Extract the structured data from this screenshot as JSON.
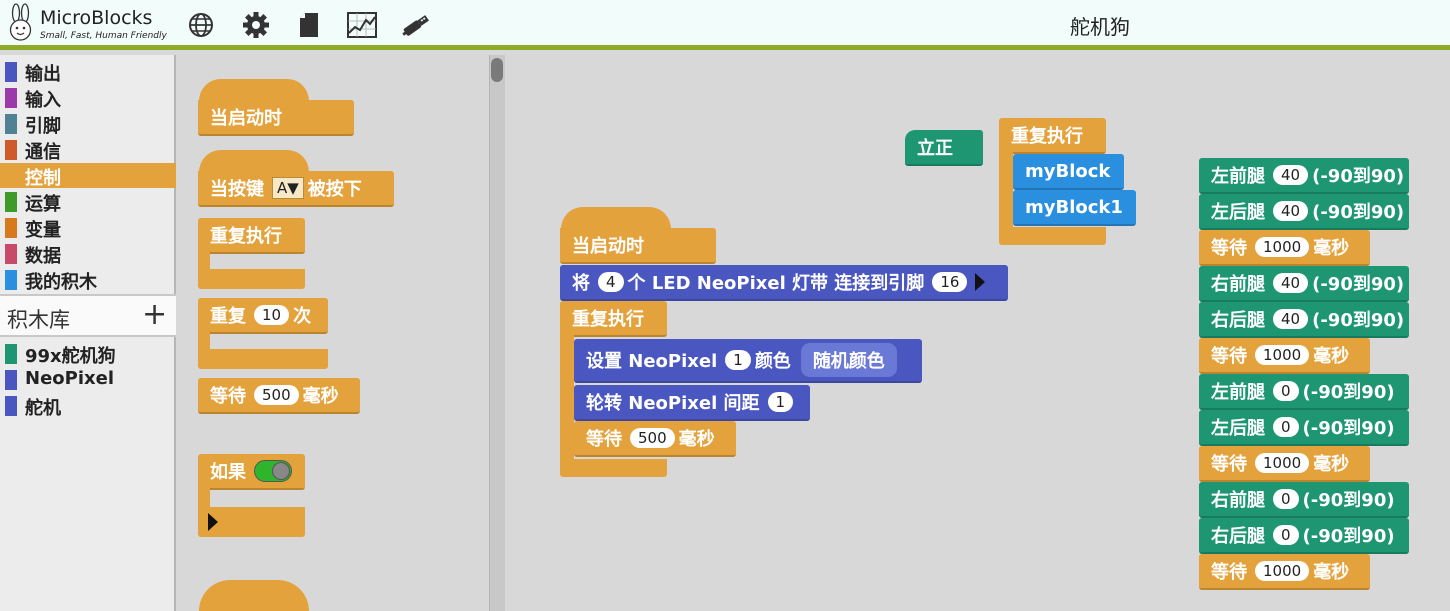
{
  "app": {
    "name": "MicroBlocks",
    "tagline": "Small, Fast, Human Friendly",
    "project_title": "舵机狗"
  },
  "toolbar": {
    "icons": [
      "globe-icon",
      "gear-icon",
      "file-icon",
      "graph-icon",
      "usb-icon"
    ]
  },
  "categories": [
    {
      "label": "输出",
      "color": "#4a57c0"
    },
    {
      "label": "输入",
      "color": "#9b3aa8"
    },
    {
      "label": "引脚",
      "color": "#4f8294"
    },
    {
      "label": "通信",
      "color": "#cf5a2b"
    },
    {
      "label": "控制",
      "color": "#e3a23c",
      "selected": true
    },
    {
      "label": "运算",
      "color": "#3e9b29"
    },
    {
      "label": "变量",
      "color": "#d77a1d"
    },
    {
      "label": "数据",
      "color": "#c84a6b"
    },
    {
      "label": "我的积木",
      "color": "#2b8fe0"
    }
  ],
  "library": {
    "header": "积木库",
    "add_label": "+",
    "items": [
      {
        "label": "99x舵机狗",
        "color": "#1e9672"
      },
      {
        "label": "NeoPixel",
        "color": "#4a57c0"
      },
      {
        "label": "舵机",
        "color": "#4a57c0"
      }
    ]
  },
  "palette": {
    "when_started": "当启动时",
    "when_button": "当按键",
    "button_value": "A▼",
    "pressed": "被按下",
    "forever": "重复执行",
    "repeat": "重复",
    "repeat_count": "10",
    "times": "次",
    "wait": "等待",
    "wait_ms": "500",
    "millis": "毫秒",
    "if": "如果"
  },
  "script": {
    "stand_block": "立正",
    "forever": "重复执行",
    "my_block": "myBlock",
    "my_block1": "myBlock1",
    "when_started": "当启动时",
    "attach": {
      "pre": "将",
      "count": "4",
      "mid": "个 LED NeoPixel 灯带 连接到引脚",
      "pin": "16"
    },
    "loop": "重复执行",
    "set_neopixel": {
      "label": "设置 NeoPixel",
      "index": "1",
      "color_label": "颜色",
      "random_color": "随机颜色"
    },
    "rotate_neopixel": {
      "label": "轮转 NeoPixel 间距",
      "value": "1"
    },
    "wait": {
      "label": "等待",
      "value": "500",
      "unit": "毫秒"
    },
    "servo_stack": [
      {
        "leg": "左前腿",
        "value": "40",
        "range": "(-90到90)",
        "kind": "leg"
      },
      {
        "leg": "左后腿",
        "value": "40",
        "range": "(-90到90)",
        "kind": "leg"
      },
      {
        "leg": "等待",
        "value": "1000",
        "range": "毫秒",
        "kind": "wait"
      },
      {
        "leg": "右前腿",
        "value": "40",
        "range": "(-90到90)",
        "kind": "leg"
      },
      {
        "leg": "右后腿",
        "value": "40",
        "range": "(-90到90)",
        "kind": "leg"
      },
      {
        "leg": "等待",
        "value": "1000",
        "range": "毫秒",
        "kind": "wait"
      },
      {
        "leg": "左前腿",
        "value": "0",
        "range": "(-90到90)",
        "kind": "leg"
      },
      {
        "leg": "左后腿",
        "value": "0",
        "range": "(-90到90)",
        "kind": "leg"
      },
      {
        "leg": "等待",
        "value": "1000",
        "range": "毫秒",
        "kind": "wait"
      },
      {
        "leg": "右前腿",
        "value": "0",
        "range": "(-90到90)",
        "kind": "leg"
      },
      {
        "leg": "右后腿",
        "value": "0",
        "range": "(-90到90)",
        "kind": "leg"
      },
      {
        "leg": "等待",
        "value": "1000",
        "range": "毫秒",
        "kind": "wait"
      }
    ]
  }
}
